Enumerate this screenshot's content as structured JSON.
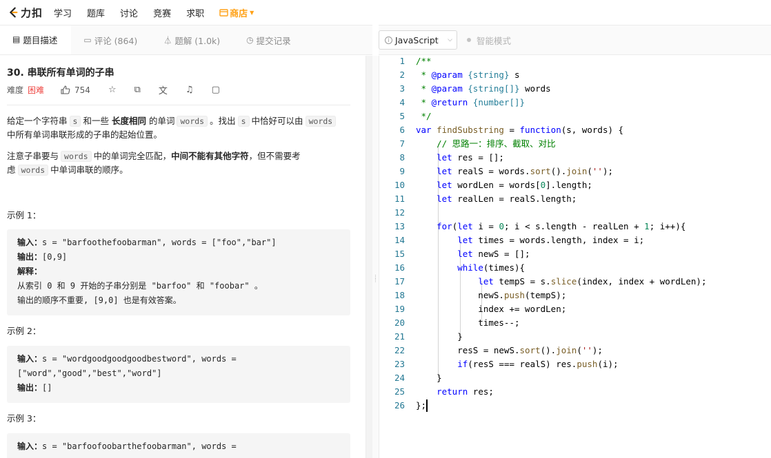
{
  "nav": {
    "logo_text": "力扣",
    "items": [
      "学习",
      "题库",
      "讨论",
      "竞赛",
      "求职"
    ],
    "store_label": "商店",
    "store_color": "#ffa116"
  },
  "left_tabs": [
    {
      "label": "题目描述",
      "icon": "description-icon",
      "active": true
    },
    {
      "label": "评论 (864)",
      "icon": "comment-icon",
      "active": false
    },
    {
      "label": "题解 (1.0k)",
      "icon": "flask-icon",
      "active": false
    },
    {
      "label": "提交记录",
      "icon": "clock-icon",
      "active": false
    }
  ],
  "toolbar": {
    "language": "JavaScript",
    "smart_mode": "智能模式"
  },
  "problem": {
    "title": "30. 串联所有单词的子串",
    "difficulty_label": "难度",
    "difficulty": "困难",
    "difficulty_color": "#ef4743",
    "likes": "754",
    "desc1_a": "给定一个字符串",
    "desc1_s": "s",
    "desc1_b": "和一些",
    "desc1_bold": "长度相同",
    "desc1_c": "的单词",
    "desc1_words": "words",
    "desc1_d": "。找出",
    "desc1_s2": "s",
    "desc1_e": "中恰好可以由",
    "desc1_words2": "words",
    "desc1_f": "中所有单词串联形成的子串的起始位置。",
    "desc2_a": "注意子串要与",
    "desc2_words": "words",
    "desc2_b": "中的单词完全匹配，",
    "desc2_bold": "中间不能有其他字符",
    "desc2_c": "，但不需要考",
    "desc2_d": "虑",
    "desc2_words2": "words",
    "desc2_e": "中单词串联的顺序。",
    "examples": [
      {
        "title": "示例 1：",
        "input_label": "输入：",
        "input": "s = \"barfoothefoobarman\", words = [\"foo\",\"bar\"]",
        "output_label": "输出：",
        "output": "[0,9]",
        "explain_label": "解释：",
        "explain1": "从索引 0 和 9 开始的子串分别是 \"barfoo\" 和 \"foobar\" 。",
        "explain2": "输出的顺序不重要, [9,0] 也是有效答案。"
      },
      {
        "title": "示例 2：",
        "input_label": "输入：",
        "input": "s = \"wordgoodgoodgoodbestword\", words = [\"word\",\"good\",\"best\",\"word\"]",
        "output_label": "输出：",
        "output": "[]"
      },
      {
        "title": "示例 3：",
        "input_label": "输入：",
        "input": "s = \"barfoofoobarthefoobarman\", words ="
      }
    ]
  },
  "editor": {
    "line_numbers": [
      "1",
      "2",
      "3",
      "4",
      "5",
      "6",
      "7",
      "8",
      "9",
      "10",
      "11",
      "12",
      "13",
      "14",
      "15",
      "16",
      "17",
      "18",
      "19",
      "20",
      "21",
      "22",
      "23",
      "24",
      "25",
      "26"
    ]
  }
}
